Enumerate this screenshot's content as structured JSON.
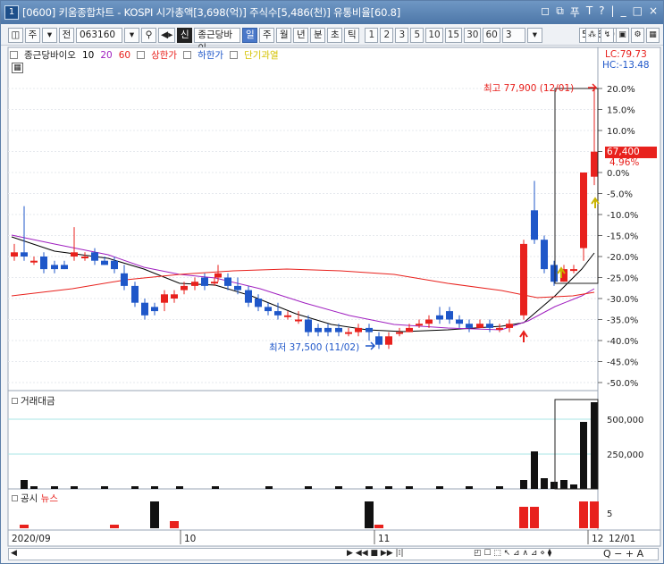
{
  "title": {
    "window_num": "1",
    "text": "[0600] 키움종합차트 - KOSPI 시가총액[3,698(억)] 주식수[5,486(천)] 유통비율[60.8]",
    "controls": [
      "◻",
      "⧉",
      "푸",
      "T",
      "?",
      "|",
      "_",
      "□",
      "×"
    ]
  },
  "toolbar": {
    "period_label": "주",
    "all_label": "전",
    "code": "063160",
    "stock_badge": "신",
    "stock_name": "종근당바이",
    "period_tabs": [
      "일",
      "주",
      "월",
      "년",
      "분",
      "초",
      "틱"
    ],
    "active_tab": "일",
    "numbers": [
      "1",
      "2",
      "3",
      "5",
      "10",
      "15",
      "30",
      "60"
    ],
    "count_select": "3",
    "count_display": "58/600"
  },
  "legend": {
    "name": "종근당바이오",
    "ma": [
      "10",
      "20",
      "60"
    ],
    "upper": "상한가",
    "lower": "하한가",
    "overheat": "단기과열"
  },
  "price_panel": {
    "lc": "LC:79.73",
    "hc": "HC:-13.48",
    "high_label": "최고 77,900 (12/01)",
    "low_label": "최저 37,500 (11/02)",
    "current_price": "67,400",
    "current_pct": "4.96%",
    "y_ticks": [
      "20.0%",
      "15.0%",
      "10.0%",
      "5.0%",
      "0.0%",
      "-5.0%",
      "-10.0%",
      "-15.0%",
      "-20.0%",
      "-25.0%",
      "-30.0%",
      "-35.0%",
      "-40.0%",
      "-45.0%",
      "-50.0%"
    ]
  },
  "volume_panel": {
    "title": "거래대금",
    "ticks": [
      "500,000",
      "250,000"
    ]
  },
  "disclosure_panel": {
    "title": "공시",
    "news": "뉴스",
    "tick": "5"
  },
  "x_axis": {
    "labels": [
      "2020/09",
      "10",
      "11",
      "12",
      "12/01"
    ]
  },
  "colors": {
    "up": "#e8211d",
    "down": "#1f57c9",
    "ma10": "#000000",
    "ma20": "#a020c0",
    "ma60": "#e8211d"
  }
}
